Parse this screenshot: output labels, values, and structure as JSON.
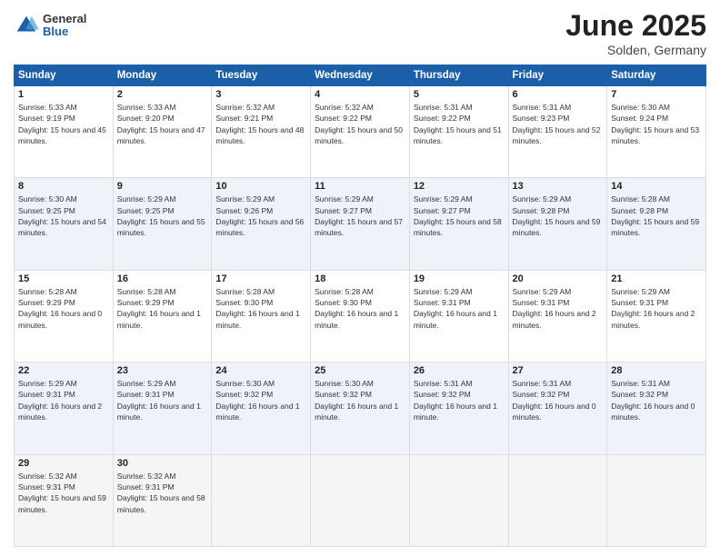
{
  "header": {
    "logo_general": "General",
    "logo_blue": "Blue",
    "title": "June 2025",
    "location": "Solden, Germany"
  },
  "weekdays": [
    "Sunday",
    "Monday",
    "Tuesday",
    "Wednesday",
    "Thursday",
    "Friday",
    "Saturday"
  ],
  "weeks": [
    [
      {
        "day": "1",
        "sunrise": "5:33 AM",
        "sunset": "9:19 PM",
        "daylight": "15 hours and 45 minutes."
      },
      {
        "day": "2",
        "sunrise": "5:33 AM",
        "sunset": "9:20 PM",
        "daylight": "15 hours and 47 minutes."
      },
      {
        "day": "3",
        "sunrise": "5:32 AM",
        "sunset": "9:21 PM",
        "daylight": "15 hours and 48 minutes."
      },
      {
        "day": "4",
        "sunrise": "5:32 AM",
        "sunset": "9:22 PM",
        "daylight": "15 hours and 50 minutes."
      },
      {
        "day": "5",
        "sunrise": "5:31 AM",
        "sunset": "9:22 PM",
        "daylight": "15 hours and 51 minutes."
      },
      {
        "day": "6",
        "sunrise": "5:31 AM",
        "sunset": "9:23 PM",
        "daylight": "15 hours and 52 minutes."
      },
      {
        "day": "7",
        "sunrise": "5:30 AM",
        "sunset": "9:24 PM",
        "daylight": "15 hours and 53 minutes."
      }
    ],
    [
      {
        "day": "8",
        "sunrise": "5:30 AM",
        "sunset": "9:25 PM",
        "daylight": "15 hours and 54 minutes."
      },
      {
        "day": "9",
        "sunrise": "5:29 AM",
        "sunset": "9:25 PM",
        "daylight": "15 hours and 55 minutes."
      },
      {
        "day": "10",
        "sunrise": "5:29 AM",
        "sunset": "9:26 PM",
        "daylight": "15 hours and 56 minutes."
      },
      {
        "day": "11",
        "sunrise": "5:29 AM",
        "sunset": "9:27 PM",
        "daylight": "15 hours and 57 minutes."
      },
      {
        "day": "12",
        "sunrise": "5:29 AM",
        "sunset": "9:27 PM",
        "daylight": "15 hours and 58 minutes."
      },
      {
        "day": "13",
        "sunrise": "5:29 AM",
        "sunset": "9:28 PM",
        "daylight": "15 hours and 59 minutes."
      },
      {
        "day": "14",
        "sunrise": "5:28 AM",
        "sunset": "9:28 PM",
        "daylight": "15 hours and 59 minutes."
      }
    ],
    [
      {
        "day": "15",
        "sunrise": "5:28 AM",
        "sunset": "9:29 PM",
        "daylight": "16 hours and 0 minutes."
      },
      {
        "day": "16",
        "sunrise": "5:28 AM",
        "sunset": "9:29 PM",
        "daylight": "16 hours and 1 minute."
      },
      {
        "day": "17",
        "sunrise": "5:28 AM",
        "sunset": "9:30 PM",
        "daylight": "16 hours and 1 minute."
      },
      {
        "day": "18",
        "sunrise": "5:28 AM",
        "sunset": "9:30 PM",
        "daylight": "16 hours and 1 minute."
      },
      {
        "day": "19",
        "sunrise": "5:29 AM",
        "sunset": "9:31 PM",
        "daylight": "16 hours and 1 minute."
      },
      {
        "day": "20",
        "sunrise": "5:29 AM",
        "sunset": "9:31 PM",
        "daylight": "16 hours and 2 minutes."
      },
      {
        "day": "21",
        "sunrise": "5:29 AM",
        "sunset": "9:31 PM",
        "daylight": "16 hours and 2 minutes."
      }
    ],
    [
      {
        "day": "22",
        "sunrise": "5:29 AM",
        "sunset": "9:31 PM",
        "daylight": "16 hours and 2 minutes."
      },
      {
        "day": "23",
        "sunrise": "5:29 AM",
        "sunset": "9:31 PM",
        "daylight": "16 hours and 1 minute."
      },
      {
        "day": "24",
        "sunrise": "5:30 AM",
        "sunset": "9:32 PM",
        "daylight": "16 hours and 1 minute."
      },
      {
        "day": "25",
        "sunrise": "5:30 AM",
        "sunset": "9:32 PM",
        "daylight": "16 hours and 1 minute."
      },
      {
        "day": "26",
        "sunrise": "5:31 AM",
        "sunset": "9:32 PM",
        "daylight": "16 hours and 1 minute."
      },
      {
        "day": "27",
        "sunrise": "5:31 AM",
        "sunset": "9:32 PM",
        "daylight": "16 hours and 0 minutes."
      },
      {
        "day": "28",
        "sunrise": "5:31 AM",
        "sunset": "9:32 PM",
        "daylight": "16 hours and 0 minutes."
      }
    ],
    [
      {
        "day": "29",
        "sunrise": "5:32 AM",
        "sunset": "9:31 PM",
        "daylight": "15 hours and 59 minutes."
      },
      {
        "day": "30",
        "sunrise": "5:32 AM",
        "sunset": "9:31 PM",
        "daylight": "15 hours and 58 minutes."
      },
      null,
      null,
      null,
      null,
      null
    ]
  ]
}
